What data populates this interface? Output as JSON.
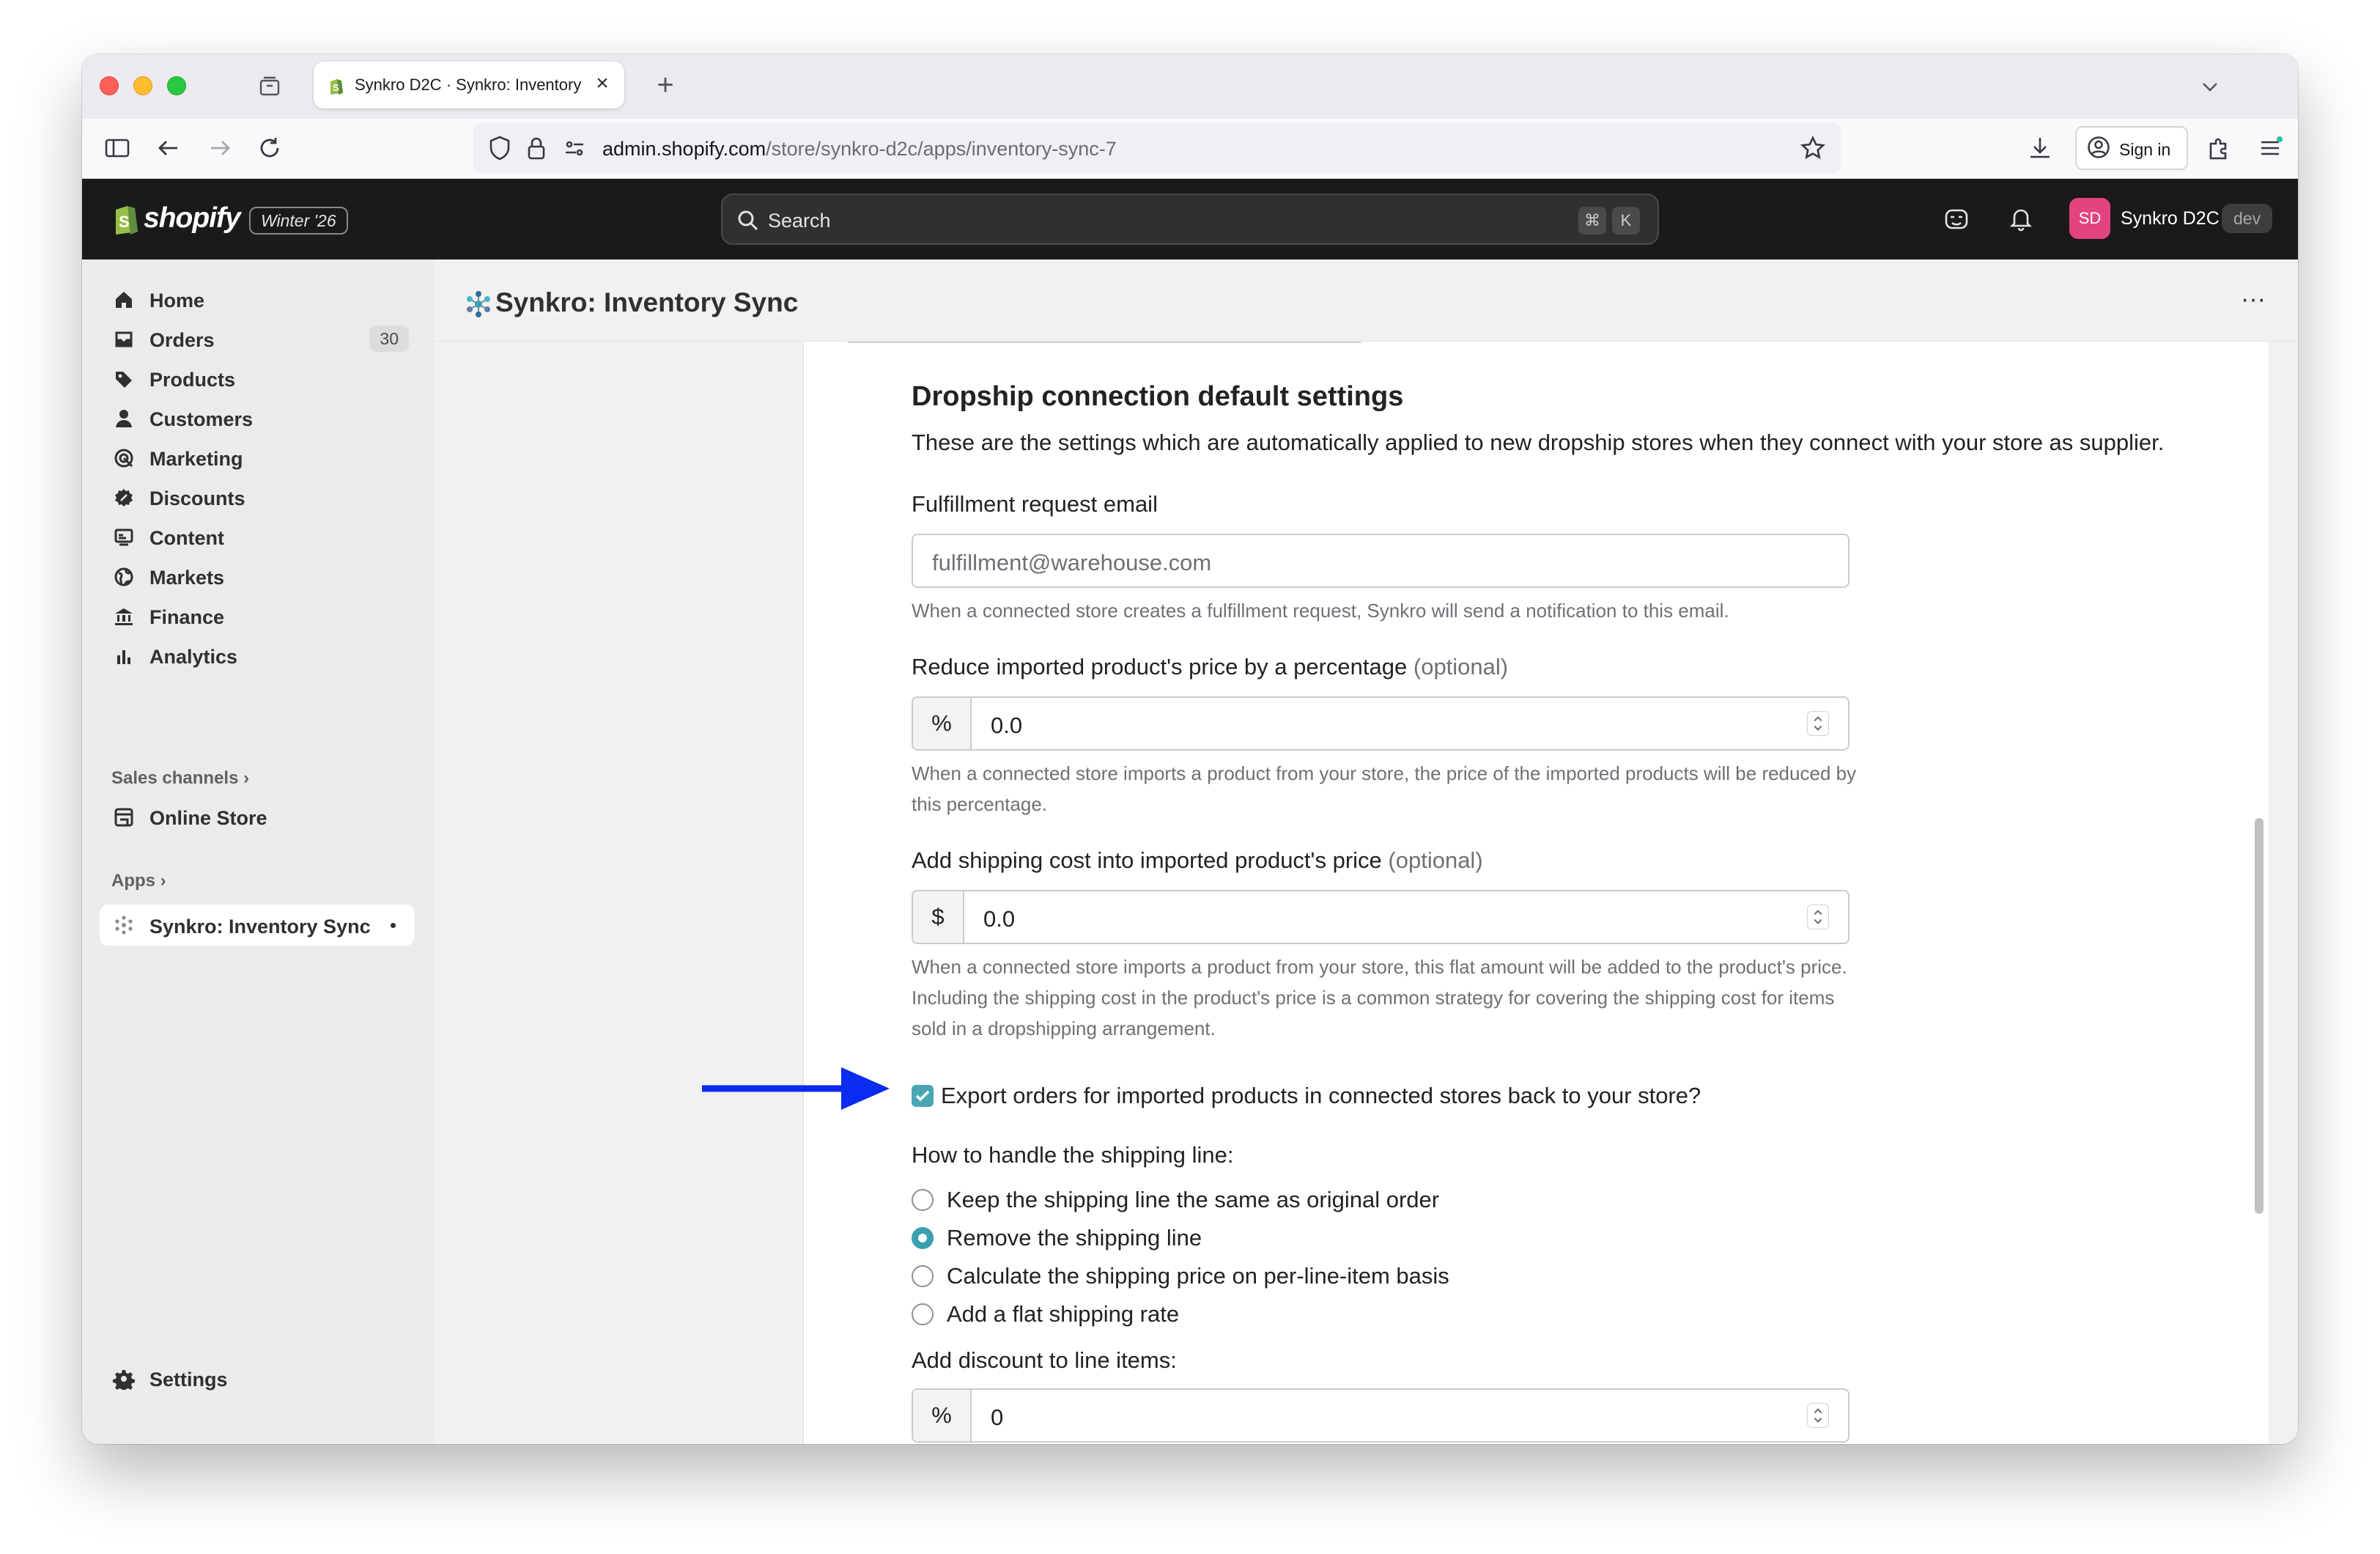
{
  "browser": {
    "tab_title": "Synkro D2C · Synkro: Inventory",
    "url_host": "admin.shopify.com",
    "url_path": "/store/synkro-d2c/apps/inventory-sync-7",
    "signin_label": "Sign in"
  },
  "shopify": {
    "logo_text": "shopify",
    "edition": "Winter '26",
    "search_placeholder": "Search",
    "kbd_cmd": "⌘",
    "kbd_k": "K",
    "avatar_initials": "SD",
    "store_name": "Synkro D2C",
    "store_badge": "dev"
  },
  "sidebar": {
    "items": [
      {
        "label": "Home",
        "icon": "home-icon"
      },
      {
        "label": "Orders",
        "icon": "orders-icon",
        "count": "30"
      },
      {
        "label": "Products",
        "icon": "tag-icon"
      },
      {
        "label": "Customers",
        "icon": "person-icon"
      },
      {
        "label": "Marketing",
        "icon": "target-icon"
      },
      {
        "label": "Discounts",
        "icon": "discount-icon"
      },
      {
        "label": "Content",
        "icon": "content-icon"
      },
      {
        "label": "Markets",
        "icon": "globe-icon"
      },
      {
        "label": "Finance",
        "icon": "bank-icon"
      },
      {
        "label": "Analytics",
        "icon": "chart-icon"
      }
    ],
    "sales_channels_label": "Sales channels",
    "online_store_label": "Online Store",
    "apps_label": "Apps",
    "active_app_label": "Synkro: Inventory Sync",
    "settings_label": "Settings"
  },
  "app": {
    "title": "Synkro: Inventory Sync",
    "more_label": "···"
  },
  "form": {
    "heading": "Dropship connection default settings",
    "description": "These are the settings which are automatically applied to new dropship stores when they connect with your store as supplier.",
    "email": {
      "label": "Fulfillment request email",
      "placeholder": "fulfillment@warehouse.com",
      "help": "When a connected store creates a fulfillment request, Synkro will send a notification to this email."
    },
    "price_reduction": {
      "label": "Reduce imported product's price by a percentage",
      "optional": "(optional)",
      "prefix": "%",
      "value": "0.0",
      "help": "When a connected store imports a product from your store, the price of the imported products will be reduced by this percentage."
    },
    "shipping_cost": {
      "label": "Add shipping cost into imported product's price",
      "optional": "(optional)",
      "prefix": "$",
      "value": "0.0",
      "help": "When a connected store imports a product from your store, this flat amount will be added to the product's price. Including the shipping cost in the product's price is a common strategy for covering the shipping cost for items sold in a dropshipping arrangement."
    },
    "export_orders": {
      "label": "Export orders for imported products in connected stores back to your store?",
      "checked": true
    },
    "shipping_line": {
      "label": "How to handle the shipping line:",
      "options": [
        {
          "label": "Keep the shipping line the same as original order",
          "selected": false
        },
        {
          "label": "Remove the shipping line",
          "selected": true
        },
        {
          "label": "Calculate the shipping price on per-line-item basis",
          "selected": false
        },
        {
          "label": "Add a flat shipping rate",
          "selected": false
        }
      ]
    },
    "line_discount": {
      "label": "Add discount to line items:",
      "prefix": "%",
      "value": "0"
    }
  },
  "colors": {
    "arrow": "#0b2bf0",
    "accent": "#3a9fae",
    "shopify_bar": "#1a1a1a"
  }
}
